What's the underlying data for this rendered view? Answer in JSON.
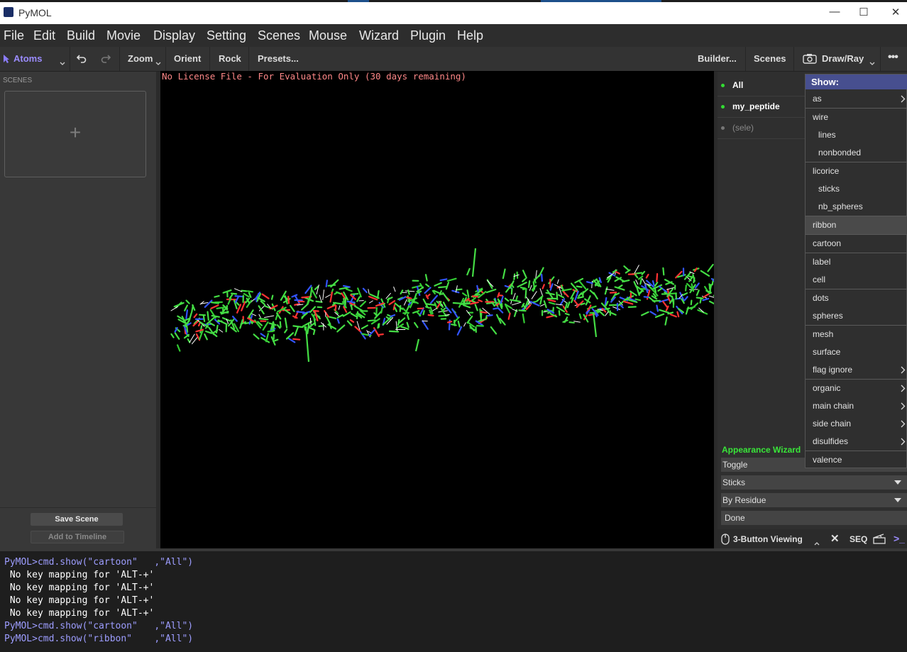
{
  "window": {
    "title": "PyMOL",
    "controls": [
      "—",
      "☐",
      "✕"
    ]
  },
  "menubar": {
    "items": [
      "File",
      "Edit",
      "Build",
      "Movie",
      "Display",
      "Setting",
      "Scenes",
      "Mouse",
      "Wizard",
      "Plugin",
      "Help"
    ]
  },
  "toolbar": {
    "mode_label": "Atoms",
    "zoom_label": "Zoom",
    "orient_label": "Orient",
    "rock_label": "Rock",
    "presets_label": "Presets...",
    "builder_label": "Builder...",
    "scenes_label": "Scenes",
    "drawray_label": "Draw/Ray",
    "more_label": "•••"
  },
  "scenes_panel": {
    "label": "SCENES",
    "add_symbol": "+",
    "save_label": "Save Scene",
    "timeline_label": "Add to Timeline"
  },
  "viewport": {
    "license_text": "No License File - For Evaluation Only (30 days remaining)"
  },
  "objects": [
    {
      "name": "All",
      "dot_color": "#33dd33",
      "text_color": "#ffffff",
      "bold": true
    },
    {
      "name": "my_peptide",
      "dot_color": "#33dd33",
      "text_color": "#ffffff",
      "bold": true
    },
    {
      "name": "(sele)",
      "dot_color": "#777777",
      "text_color": "#888888",
      "bold": false
    }
  ],
  "appearance_wizard": {
    "title": "Appearance Wizard",
    "rows": [
      {
        "label": "Toggle",
        "dropdown": false
      },
      {
        "label": "Sticks",
        "dropdown": true
      },
      {
        "label": "By Residue",
        "dropdown": true
      },
      {
        "label": "Done",
        "dropdown": false
      }
    ]
  },
  "bottom_bar": {
    "viewing_label": "3-Button Viewing",
    "close_symbol": "✕",
    "seq_label": "SEQ",
    "prompt_symbol": ">_"
  },
  "show_menu": {
    "header": "Show:",
    "items": [
      {
        "label": "as",
        "sub": false,
        "arrow": true,
        "sep_after": true
      },
      {
        "label": "wire",
        "sub": false,
        "arrow": false,
        "sep_after": false
      },
      {
        "label": "lines",
        "sub": true,
        "arrow": false,
        "sep_after": false
      },
      {
        "label": "nonbonded",
        "sub": true,
        "arrow": false,
        "sep_after": true
      },
      {
        "label": "licorice",
        "sub": false,
        "arrow": false,
        "sep_after": false
      },
      {
        "label": "sticks",
        "sub": true,
        "arrow": false,
        "sep_after": false
      },
      {
        "label": "nb_spheres",
        "sub": true,
        "arrow": false,
        "sep_after": true
      },
      {
        "label": "ribbon",
        "sub": false,
        "arrow": false,
        "sep_after": true,
        "highlight": true
      },
      {
        "label": "cartoon",
        "sub": false,
        "arrow": false,
        "sep_after": true
      },
      {
        "label": "label",
        "sub": false,
        "arrow": false,
        "sep_after": false
      },
      {
        "label": "cell",
        "sub": false,
        "arrow": false,
        "sep_after": true
      },
      {
        "label": "dots",
        "sub": false,
        "arrow": false,
        "sep_after": false
      },
      {
        "label": "spheres",
        "sub": false,
        "arrow": false,
        "sep_after": true
      },
      {
        "label": "mesh",
        "sub": false,
        "arrow": false,
        "sep_after": false
      },
      {
        "label": "surface",
        "sub": false,
        "arrow": false,
        "sep_after": false
      },
      {
        "label": "flag ignore",
        "sub": false,
        "arrow": true,
        "sep_after": true
      },
      {
        "label": "organic",
        "sub": false,
        "arrow": true,
        "sep_after": false
      },
      {
        "label": "main chain",
        "sub": false,
        "arrow": true,
        "sep_after": false
      },
      {
        "label": "side chain",
        "sub": false,
        "arrow": true,
        "sep_after": false
      },
      {
        "label": "disulfides",
        "sub": false,
        "arrow": true,
        "sep_after": true
      },
      {
        "label": "valence",
        "sub": false,
        "arrow": false,
        "sep_after": false
      }
    ]
  },
  "console": {
    "lines": [
      {
        "text": "PyMOL>cmd.show(\"cartoon\"   ,\"All\")",
        "color": "#9d9dff"
      },
      {
        "text": " No key mapping for 'ALT-+'",
        "color": "#ffffff"
      },
      {
        "text": " No key mapping for 'ALT-+'",
        "color": "#ffffff"
      },
      {
        "text": " No key mapping for 'ALT-+'",
        "color": "#ffffff"
      },
      {
        "text": " No key mapping for 'ALT-+'",
        "color": "#ffffff"
      },
      {
        "text": "PyMOL>cmd.show(\"cartoon\"   ,\"All\")",
        "color": "#9d9dff"
      },
      {
        "text": "PyMOL>cmd.show(\"ribbon\"    ,\"All\")",
        "color": "#9d9dff"
      }
    ]
  }
}
